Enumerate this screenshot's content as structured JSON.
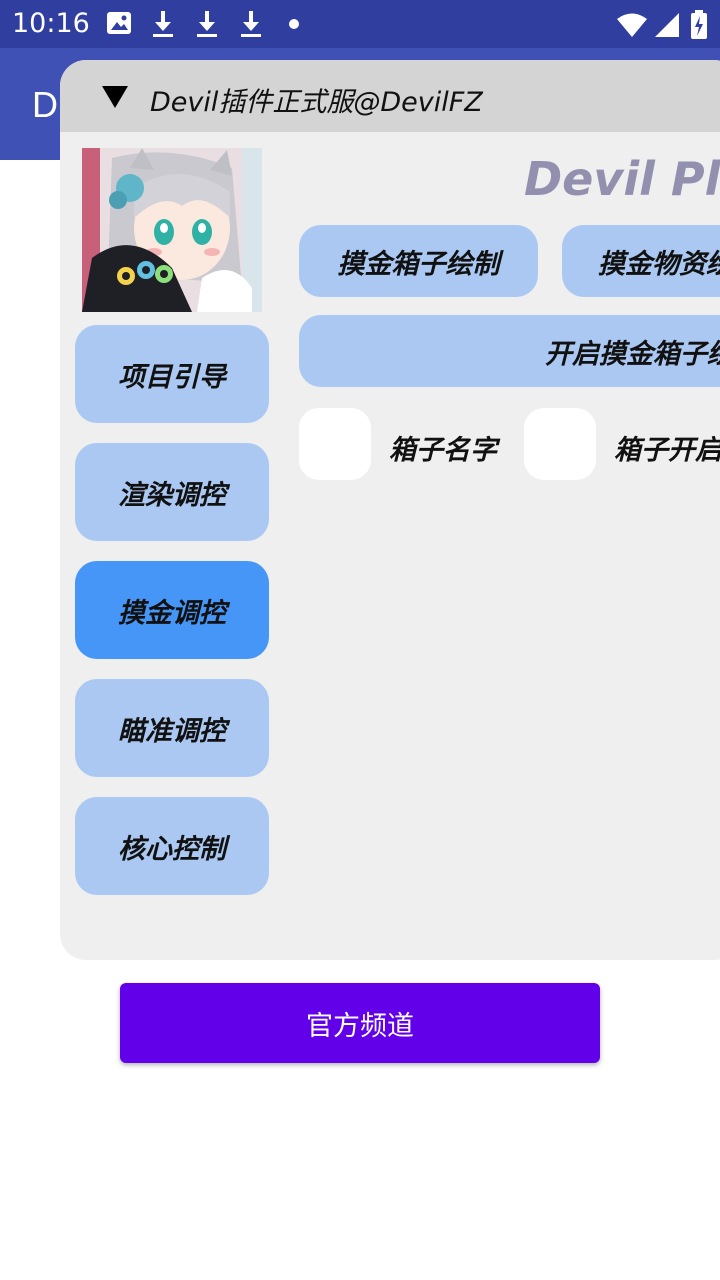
{
  "status_bar": {
    "time": "10:16",
    "icons": [
      "image-icon",
      "download-icon",
      "download-icon",
      "download-icon",
      "dot-icon",
      "wifi-icon",
      "signal-icon",
      "battery-icon"
    ]
  },
  "app_bar": {
    "title": "D"
  },
  "panel": {
    "title": "Devil插件正式服@DevilFZ",
    "brand": "Devil Plu",
    "nav": [
      {
        "label": "项目引导"
      },
      {
        "label": "渲染调控"
      },
      {
        "label": "摸金调控",
        "active": true
      },
      {
        "label": "瞄准调控"
      },
      {
        "label": "核心控制"
      }
    ],
    "features": {
      "box_draw": "摸金箱子绘制",
      "item_draw": "摸金物资绘",
      "open_box": "开启摸金箱子绘"
    },
    "checkboxes": [
      {
        "label": "箱子名字"
      },
      {
        "label": "箱子开启"
      }
    ]
  },
  "channel_button": "官方频道",
  "colors": {
    "status_bar": "#303f9f",
    "app_bar": "#3f51b5",
    "button_inactive": "#aac8f2",
    "button_active": "#4596f6",
    "channel": "#6200ea"
  }
}
